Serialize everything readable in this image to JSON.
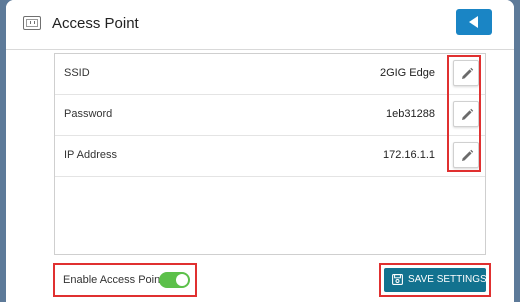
{
  "header": {
    "title": "Access Point",
    "icon": "access-point-icon",
    "back_icon": "back-arrow-icon",
    "accent_color": "#1a85c5"
  },
  "settings": {
    "rows": [
      {
        "label": "SSID",
        "value": "2GIG Edge",
        "action_icon": "pencil-icon"
      },
      {
        "label": "Password",
        "value": "1eb31288",
        "action_icon": "pencil-icon"
      },
      {
        "label": "IP Address",
        "value": "172.16.1.1",
        "action_icon": "pencil-icon"
      }
    ]
  },
  "footer": {
    "enable_label": "Enable Access Point",
    "enable_on": true,
    "toggle_color": "#5cc04a",
    "save_label": "SAVE SETTINGS",
    "save_color": "#12728f"
  },
  "highlight_color": "#e03030"
}
